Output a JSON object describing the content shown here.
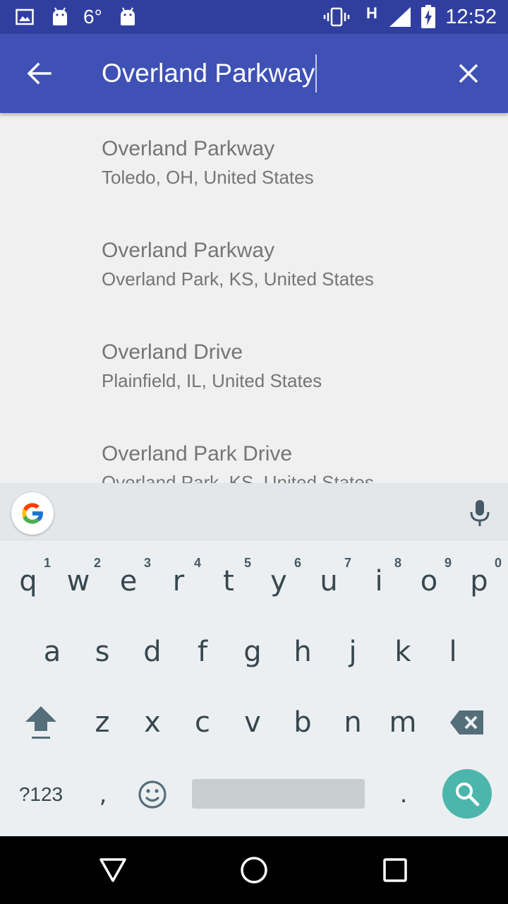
{
  "status_bar": {
    "temperature": "6°",
    "network_type": "H",
    "time": "12:52",
    "icons": [
      "image-icon",
      "android-icon",
      "android-icon",
      "vibrate-icon",
      "signal-icon",
      "battery-charging-icon"
    ]
  },
  "search_bar": {
    "back_icon": "arrow-back-icon",
    "query": "Overland Parkway",
    "clear_icon": "close-icon"
  },
  "results": [
    {
      "title": "Overland Parkway",
      "subtitle": "Toledo, OH, United States"
    },
    {
      "title": "Overland Parkway",
      "subtitle": "Overland Park, KS, United States"
    },
    {
      "title": "Overland Drive",
      "subtitle": "Plainfield, IL, United States"
    },
    {
      "title": "Overland Park Drive",
      "subtitle": "Overland Park, KS, United States"
    }
  ],
  "keyboard": {
    "row1": [
      {
        "key": "q",
        "hint": "1"
      },
      {
        "key": "w",
        "hint": "2"
      },
      {
        "key": "e",
        "hint": "3"
      },
      {
        "key": "r",
        "hint": "4"
      },
      {
        "key": "t",
        "hint": "5"
      },
      {
        "key": "y",
        "hint": "6"
      },
      {
        "key": "u",
        "hint": "7"
      },
      {
        "key": "i",
        "hint": "8"
      },
      {
        "key": "o",
        "hint": "9"
      },
      {
        "key": "p",
        "hint": "0"
      }
    ],
    "row2": [
      "a",
      "s",
      "d",
      "f",
      "g",
      "h",
      "j",
      "k",
      "l"
    ],
    "row3": [
      "z",
      "x",
      "c",
      "v",
      "b",
      "n",
      "m"
    ],
    "symbols_label": "?123",
    "comma": ",",
    "period": ".",
    "accent_color": "#4db6ac"
  },
  "colors": {
    "status_bar": "#303f9f",
    "toolbar": "#3f51b5",
    "background": "#f0f0f0"
  }
}
